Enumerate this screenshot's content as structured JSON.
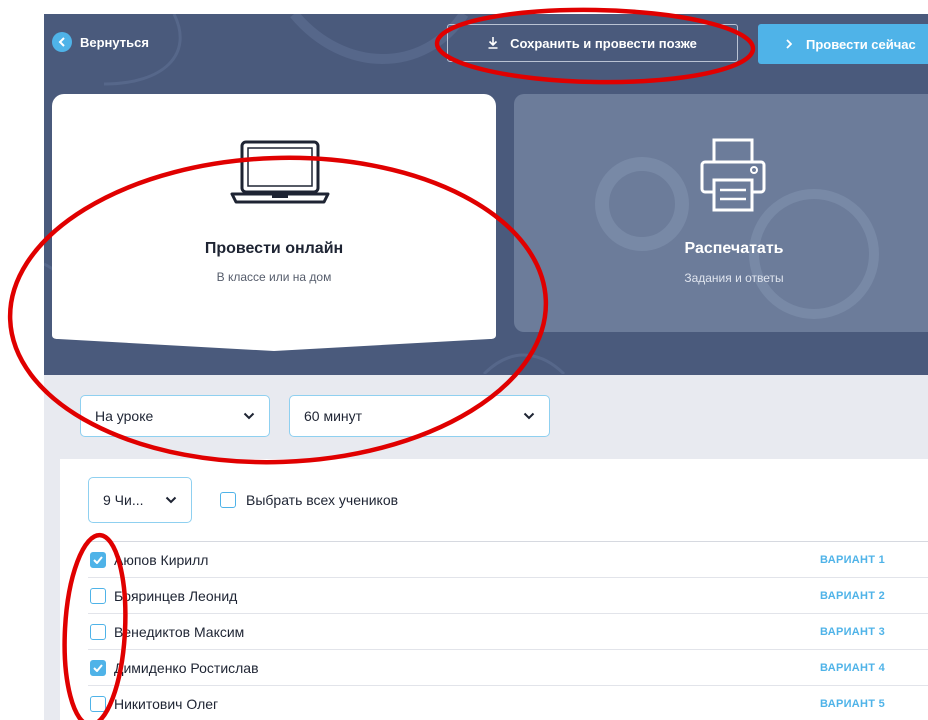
{
  "header": {
    "back_label": "Вернуться",
    "save_label": "Сохранить и провести позже",
    "run_now_label": "Провести сейчас"
  },
  "modes": {
    "online": {
      "title": "Провести онлайн",
      "subtitle": "В классе или на дом",
      "icon": "laptop-icon"
    },
    "print": {
      "title": "Распечатать",
      "subtitle": "Задания и ответы",
      "icon": "printer-icon"
    }
  },
  "settings": {
    "mode_select": "На уроке",
    "duration_select": "60 минут",
    "class_select": "9 Чи...",
    "select_all_label": "Выбрать всех учеников"
  },
  "students": [
    {
      "name": "Аюпов Кирилл",
      "variant": "ВАРИАНТ 1",
      "checked": true
    },
    {
      "name": "Бояринцев Леонид",
      "variant": "ВАРИАНТ 2",
      "checked": false
    },
    {
      "name": "Венедиктов Максим",
      "variant": "ВАРИАНТ 3",
      "checked": false
    },
    {
      "name": "Димиденко Ростислав",
      "variant": "ВАРИАНТ 4",
      "checked": true
    },
    {
      "name": "Никитович Олег",
      "variant": "ВАРИАНТ 5",
      "checked": false
    }
  ],
  "colors": {
    "background": "#4a5a7c",
    "accent": "#4fb3e8",
    "print_card": "#6c7c9a",
    "annotation": "#e00000"
  }
}
